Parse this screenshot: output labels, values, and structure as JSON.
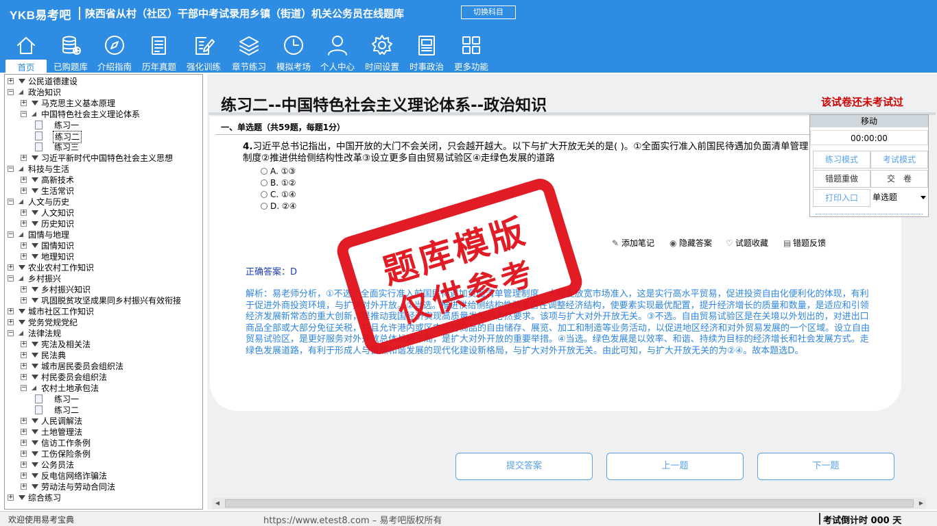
{
  "header": {
    "logo": "YKB易考吧",
    "title": "陕西省从村（社区）干部中考试录用乡镇（街道）机关公务员在线题库",
    "switch_label": "切换科目"
  },
  "nav": [
    {
      "label": "首页",
      "icon": "home-icon"
    },
    {
      "label": "已购题库",
      "icon": "database-icon"
    },
    {
      "label": "介绍指南",
      "icon": "compass-icon"
    },
    {
      "label": "历年真题",
      "icon": "document-list-icon"
    },
    {
      "label": "强化训练",
      "icon": "edit-icon"
    },
    {
      "label": "章节练习",
      "icon": "layers-icon"
    },
    {
      "label": "模拟考场",
      "icon": "clock-icon"
    },
    {
      "label": "个人中心",
      "icon": "user-icon"
    },
    {
      "label": "时间设置",
      "icon": "gear-icon"
    },
    {
      "label": "时事政治",
      "icon": "newspaper-icon"
    },
    {
      "label": "更多功能",
      "icon": "grid-icon"
    }
  ],
  "tree": [
    {
      "label": "公民道德建设",
      "level": 0,
      "kind": "folder",
      "open": false
    },
    {
      "label": "政治知识",
      "level": 0,
      "kind": "folder",
      "open": true
    },
    {
      "label": "马克思主义基本原理",
      "level": 1,
      "kind": "folder",
      "open": false
    },
    {
      "label": "中国特色社会主义理论体系",
      "level": 1,
      "kind": "folder",
      "open": true
    },
    {
      "label": "练习一",
      "level": 2,
      "kind": "doc"
    },
    {
      "label": "练习二",
      "level": 2,
      "kind": "doc",
      "selected": true
    },
    {
      "label": "练习三",
      "level": 2,
      "kind": "doc"
    },
    {
      "label": "习近平新时代中国特色社会主义思想",
      "level": 1,
      "kind": "folder",
      "open": false
    },
    {
      "label": "科技与生活",
      "level": 0,
      "kind": "folder",
      "open": true
    },
    {
      "label": "高新技术",
      "level": 1,
      "kind": "folder",
      "open": false
    },
    {
      "label": "生活常识",
      "level": 1,
      "kind": "folder",
      "open": false
    },
    {
      "label": "人文与历史",
      "level": 0,
      "kind": "folder",
      "open": true
    },
    {
      "label": "人文知识",
      "level": 1,
      "kind": "folder",
      "open": false
    },
    {
      "label": "历史知识",
      "level": 1,
      "kind": "folder",
      "open": false
    },
    {
      "label": "国情与地理",
      "level": 0,
      "kind": "folder",
      "open": true
    },
    {
      "label": "国情知识",
      "level": 1,
      "kind": "folder",
      "open": false
    },
    {
      "label": "地理知识",
      "level": 1,
      "kind": "folder",
      "open": false
    },
    {
      "label": "农业农村工作知识",
      "level": 0,
      "kind": "folder",
      "open": false
    },
    {
      "label": "乡村振兴",
      "level": 0,
      "kind": "folder",
      "open": true
    },
    {
      "label": "乡村振兴知识",
      "level": 1,
      "kind": "folder",
      "open": false
    },
    {
      "label": "巩固脱贫攻坚成果同乡村振兴有效衔接",
      "level": 1,
      "kind": "folder",
      "open": false
    },
    {
      "label": "城市社区工作知识",
      "level": 0,
      "kind": "folder",
      "open": false
    },
    {
      "label": "党务党规党纪",
      "level": 0,
      "kind": "folder",
      "open": false
    },
    {
      "label": "法律法规",
      "level": 0,
      "kind": "folder",
      "open": true
    },
    {
      "label": "宪法及相关法",
      "level": 1,
      "kind": "folder",
      "open": false
    },
    {
      "label": "民法典",
      "level": 1,
      "kind": "folder",
      "open": false
    },
    {
      "label": "城市居民委员会组织法",
      "level": 1,
      "kind": "folder",
      "open": false
    },
    {
      "label": "村民委员会组织法",
      "level": 1,
      "kind": "folder",
      "open": false
    },
    {
      "label": "农村土地承包法",
      "level": 1,
      "kind": "folder",
      "open": true
    },
    {
      "label": "练习一",
      "level": 2,
      "kind": "doc"
    },
    {
      "label": "练习二",
      "level": 2,
      "kind": "doc"
    },
    {
      "label": "人民调解法",
      "level": 1,
      "kind": "folder",
      "open": false
    },
    {
      "label": "土地管理法",
      "level": 1,
      "kind": "folder",
      "open": false
    },
    {
      "label": "信访工作条例",
      "level": 1,
      "kind": "folder",
      "open": false
    },
    {
      "label": "工伤保险条例",
      "level": 1,
      "kind": "folder",
      "open": false
    },
    {
      "label": "公务员法",
      "level": 1,
      "kind": "folder",
      "open": false
    },
    {
      "label": "反电信网络诈骗法",
      "level": 1,
      "kind": "folder",
      "open": false
    },
    {
      "label": "劳动法与劳动合同法",
      "level": 1,
      "kind": "folder",
      "open": false
    },
    {
      "label": "综合练习",
      "level": 0,
      "kind": "folder",
      "open": false
    }
  ],
  "main": {
    "paper_title": "练习二--中国特色社会主义理论体系--政治知识",
    "not_taken": "该试卷还未考试过",
    "section_title": "一、单选题（共59题，每题1分）",
    "question_number": "4.",
    "question_text": "习近平总书记指出，中国开放的大门不会关闭，只会越开越大。以下与扩大开放无关的是( )。①全面实行准入前国民待遇加负面清单管理制度②推进供给侧结构性改革③设立更多自由贸易试验区④走绿色发展的道路",
    "options": [
      "A. ①③",
      "B. ①②",
      "C. ①④",
      "D. ②④"
    ],
    "tools": [
      {
        "label": "添加笔记",
        "icon": "pencil-icon"
      },
      {
        "label": "隐藏答案",
        "icon": "eye-icon"
      },
      {
        "label": "试题收藏",
        "icon": "heart-icon"
      },
      {
        "label": "错题反馈",
        "icon": "feedback-icon"
      }
    ],
    "answer_label": "正确答案：D",
    "analysis": "解析：易老师分析，①不选。全面实行准入前国民待遇加负面清单管理制度，大幅度放宽市场准入，这是实行高水平贸易，促进投资自由化便利化的体现，有利于促进外商投资环境，与扩大对外开放。②当选。推进供给侧结构性改革旨在调整经济结构，使要素实现最优配置，提升经济增长的质量和数量，是适应和引领经济发展新常态的重大创新，是推动我国经济实现高质量发展的必然要求。该项与扩大对外开放无关。③不选。自由贸易试验区是在关境以外划出的，对进出口商品全部或大部分免征关税，并且允许港内或区内进行商品的自由储存、展览、加工和制造等业务活动，以促进地区经济和对外贸易发展的一个区域。设立自由贸易试验区，是更好服务对外开放总体战略布局，是扩大对外开放的重要举措。④当选。绿色发展是以效率、和谐、持续为目标的经济增长和社会发展方式。走绿色发展道路，有利于形成人与自然和谐发展的现代化建设新格局，与扩大对外开放无关。由此可知，与扩大开放无关的为②④。故本题选D。",
    "buttons": {
      "submit": "提交答案",
      "prev": "上一题",
      "next": "下一题"
    }
  },
  "control": {
    "move_label": "移动",
    "timer": "00:00:00",
    "practice_mode": "练习模式",
    "exam_mode": "考试模式",
    "redo_wrong": "错题重做",
    "submit_paper": "交　卷",
    "print": "打印入口",
    "question_type": "单选题"
  },
  "stamp": {
    "line1": "题库模版",
    "line2": "仅供参考"
  },
  "status": {
    "left": "欢迎使用易考宝典",
    "middle": "https://www.etest8.com – 易考吧版权所有",
    "right": "考试倒计时 000 天"
  },
  "colors": {
    "accent": "#2e8ce2",
    "link_blue": "#5aa2e8",
    "alert_red": "#cc0000",
    "stamp_red": "#e0101a"
  }
}
